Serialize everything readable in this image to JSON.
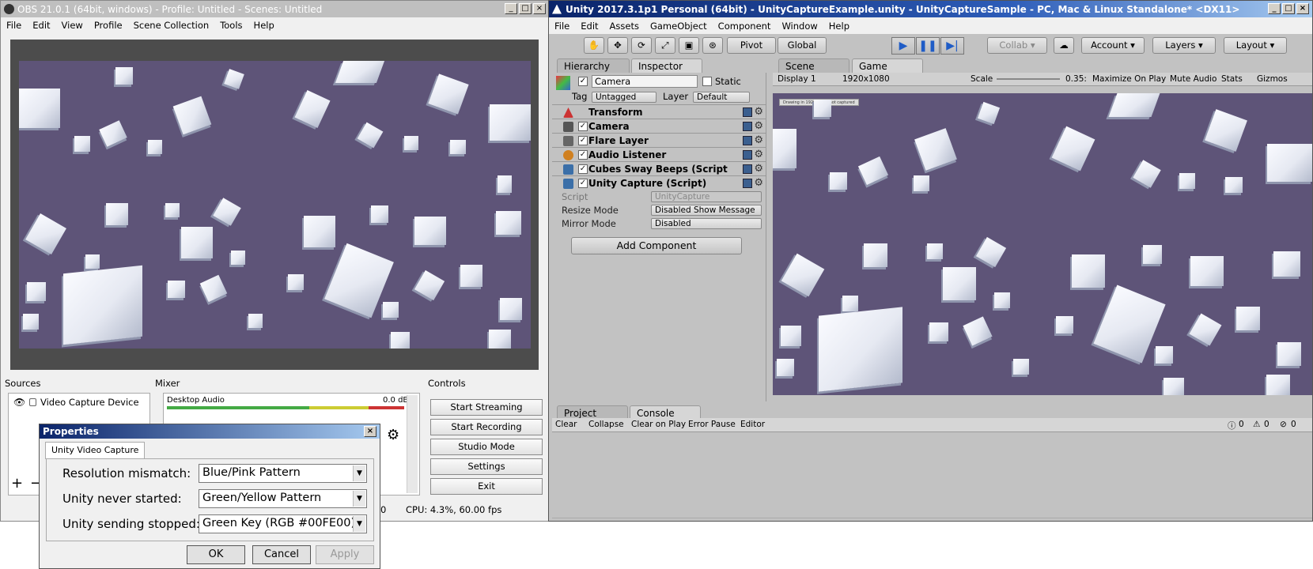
{
  "obs": {
    "title": "OBS 21.0.1 (64bit, windows) - Profile: Untitled - Scenes: Untitled",
    "menu": [
      "File",
      "Edit",
      "View",
      "Profile",
      "Scene Collection",
      "Tools",
      "Help"
    ],
    "docks": {
      "sources": "Sources",
      "mixer": "Mixer",
      "controls": "Controls"
    },
    "source_item": "Video Capture Device",
    "mixer_channel": "Desktop Audio",
    "mixer_level": "0.0 dB",
    "controls": [
      "Start Streaming",
      "Start Recording",
      "Studio Mode",
      "Settings",
      "Exit"
    ],
    "status_cpu": "CPU: 4.3%, 60.00 fps",
    "status_zero": "0"
  },
  "properties": {
    "title": "Properties",
    "tab": "Unity Video Capture",
    "rows": [
      {
        "label": "Resolution mismatch:",
        "value": "Blue/Pink Pattern"
      },
      {
        "label": "Unity never started:",
        "value": "Green/Yellow Pattern"
      },
      {
        "label": "Unity sending stopped:",
        "value": "Green Key (RGB #00FE00)"
      }
    ],
    "ok": "OK",
    "cancel": "Cancel",
    "apply": "Apply"
  },
  "unity": {
    "title": "Unity 2017.3.1p1 Personal (64bit) - UnityCaptureExample.unity - UnityCaptureSample - PC, Mac & Linux Standalone* <DX11>",
    "menu": [
      "File",
      "Edit",
      "Assets",
      "GameObject",
      "Component",
      "Window",
      "Help"
    ],
    "toolbar": {
      "pivot": "Pivot",
      "global": "Global",
      "collab": "Collab",
      "account": "Account",
      "layers": "Layers",
      "layout": "Layout"
    },
    "tabs": {
      "hierarchy": "Hierarchy",
      "inspector": "Inspector",
      "scene": "Scene",
      "game": "Game",
      "project": "Project",
      "console": "Console"
    },
    "inspector": {
      "object_name": "Camera",
      "static": "Static",
      "tag_label": "Tag",
      "tag_value": "Untagged",
      "layer_label": "Layer",
      "layer_value": "Default",
      "components": [
        "Transform",
        "Camera",
        "Flare Layer",
        "Audio Listener",
        "Cubes Sway Beeps (Script",
        "Unity Capture (Script)"
      ],
      "script_label": "Script",
      "script_value": "UnityCapture",
      "resize_label": "Resize Mode",
      "resize_value": "Disabled Show Message",
      "mirror_label": "Mirror Mode",
      "mirror_value": "Disabled",
      "add_component": "Add Component"
    },
    "gamebar": {
      "display": "Display 1",
      "resolution": "1920x1080",
      "scale_label": "Scale",
      "scale_value": "0.35:",
      "maximize": "Maximize On Play",
      "mute": "Mute Audio",
      "stats": "Stats",
      "gizmos": "Gizmos",
      "overlay": "Drawing in 1920x1080 not captured"
    },
    "console": {
      "clear": "Clear",
      "collapse": "Collapse",
      "clear_on_play": "Clear on Play",
      "error_pause": "Error Pause",
      "editor": "Editor",
      "c1": "0",
      "c2": "0",
      "c3": "0"
    }
  },
  "colors": {
    "scene_bg": "#5e5478",
    "unity_panel": "#c2c2c2",
    "play_blue": "#1f5cc6"
  }
}
